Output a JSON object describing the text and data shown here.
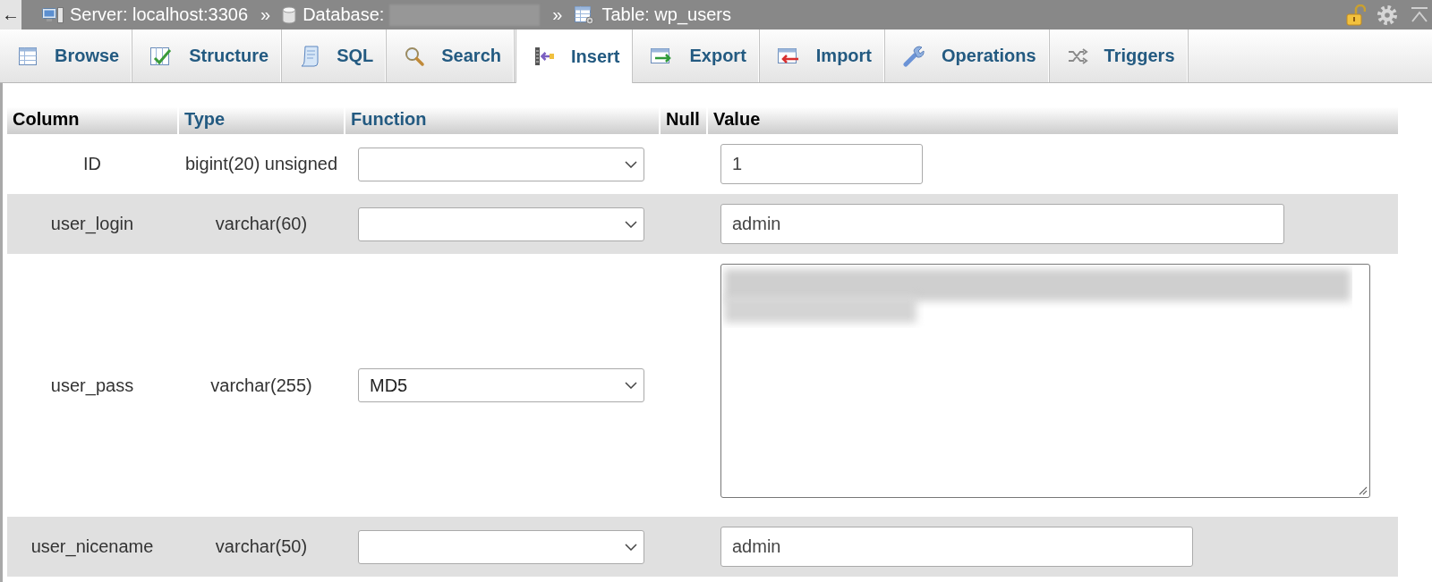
{
  "breadcrumb": {
    "back": "←",
    "items": [
      {
        "kind": "server",
        "label": "Server: localhost:3306"
      },
      {
        "kind": "database",
        "separator": "»",
        "label": "Database:",
        "redacted": true
      },
      {
        "kind": "table",
        "separator": "»",
        "label": "Table: wp_users"
      }
    ]
  },
  "tabs": [
    {
      "kind": "browse",
      "label": "Browse",
      "selected": false
    },
    {
      "kind": "structure",
      "label": "Structure",
      "selected": false
    },
    {
      "kind": "sql",
      "label": "SQL",
      "selected": false
    },
    {
      "kind": "search",
      "label": "Search",
      "selected": false
    },
    {
      "kind": "insert",
      "label": "Insert",
      "selected": true
    },
    {
      "kind": "export",
      "label": "Export",
      "selected": false
    },
    {
      "kind": "import",
      "label": "Import",
      "selected": false
    },
    {
      "kind": "operations",
      "label": "Operations",
      "selected": false
    },
    {
      "kind": "triggers",
      "label": "Triggers",
      "selected": false
    }
  ],
  "form": {
    "columns": [
      {
        "label": "Column",
        "link": false
      },
      {
        "label": "Type",
        "link": true
      },
      {
        "label": "Function",
        "link": true
      },
      {
        "label": "Null",
        "link": false
      },
      {
        "label": "Value",
        "link": false
      }
    ],
    "rows": [
      {
        "column": "ID",
        "type": "bigint(20) unsigned",
        "kind": "input",
        "value": "1"
      },
      {
        "column": "user_login",
        "type": "varchar(60)",
        "kind": "input",
        "value": "admin"
      },
      {
        "column": "user_pass",
        "type": "varchar(255)",
        "function": "MD5",
        "kind": "textarea",
        "redacted": true
      },
      {
        "column": "user_nicename",
        "type": "varchar(50)",
        "kind": "input",
        "value": "admin"
      }
    ]
  }
}
